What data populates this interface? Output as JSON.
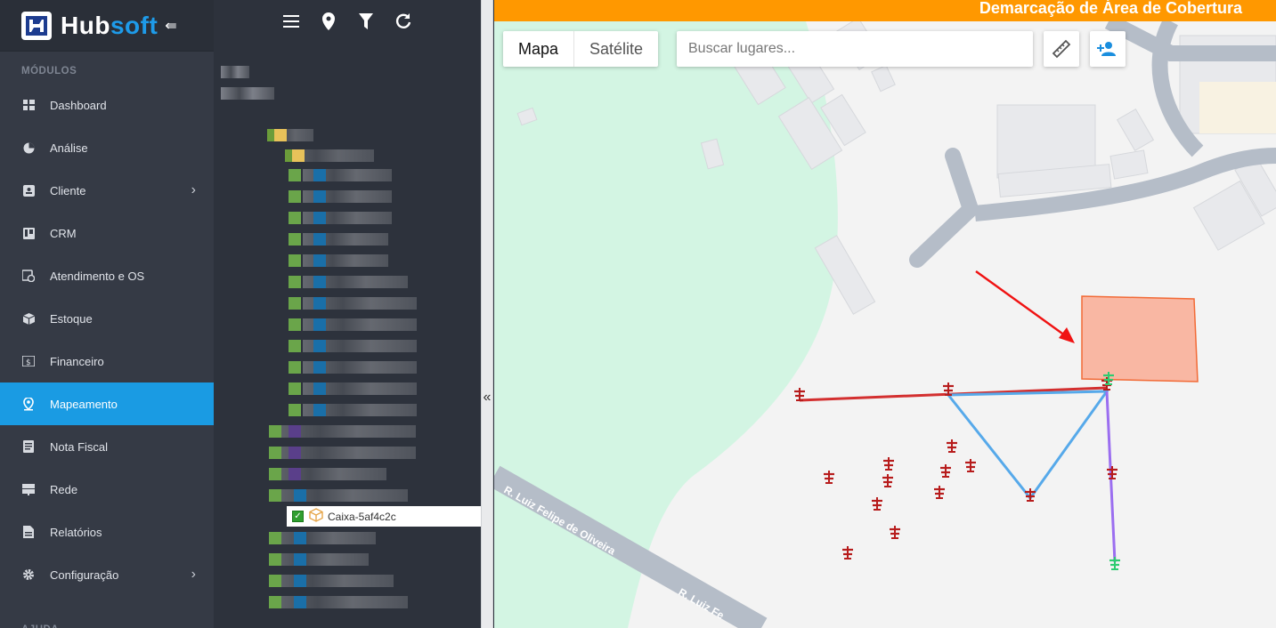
{
  "brand": {
    "name_a": "Hub",
    "name_b": "soft"
  },
  "sidebar": {
    "section_modules": "MÓDULOS",
    "section_help": "AJUDA",
    "items": [
      {
        "label": "Dashboard",
        "icon": "dashboard-icon"
      },
      {
        "label": "Análise",
        "icon": "pie-chart-icon"
      },
      {
        "label": "Cliente",
        "icon": "contact-card-icon",
        "has_submenu": true
      },
      {
        "label": "CRM",
        "icon": "kanban-icon"
      },
      {
        "label": "Atendimento e OS",
        "icon": "calendar-clock-icon"
      },
      {
        "label": "Estoque",
        "icon": "box-icon"
      },
      {
        "label": "Financeiro",
        "icon": "money-icon"
      },
      {
        "label": "Mapeamento",
        "icon": "map-pin-icon",
        "active": true
      },
      {
        "label": "Nota Fiscal",
        "icon": "receipt-icon"
      },
      {
        "label": "Rede",
        "icon": "server-icon"
      },
      {
        "label": "Relatórios",
        "icon": "report-icon"
      },
      {
        "label": "Configuração",
        "icon": "gear-icon",
        "has_submenu": true
      }
    ]
  },
  "tree": {
    "toolbar": [
      "menu-icon",
      "location-pin-icon",
      "filter-icon",
      "refresh-icon"
    ],
    "popup_item": "Caixa-5af4c2c"
  },
  "map": {
    "header_title": "Demarcação de Área de Cobertura",
    "map_type": {
      "map": "Mapa",
      "satellite": "Satélite"
    },
    "search_placeholder": "Buscar lugares...",
    "street_label": "R. Luiz Felipe de Oliveira",
    "street_label_2": "R. Luiz Fe",
    "colors": {
      "header": "#ff9800",
      "active_nav": "#1a9be3",
      "area": "#f9b7a3",
      "red_line": "#d32f2f",
      "blue_line": "#56a9ea",
      "purple_line": "#9b6ef0"
    }
  }
}
